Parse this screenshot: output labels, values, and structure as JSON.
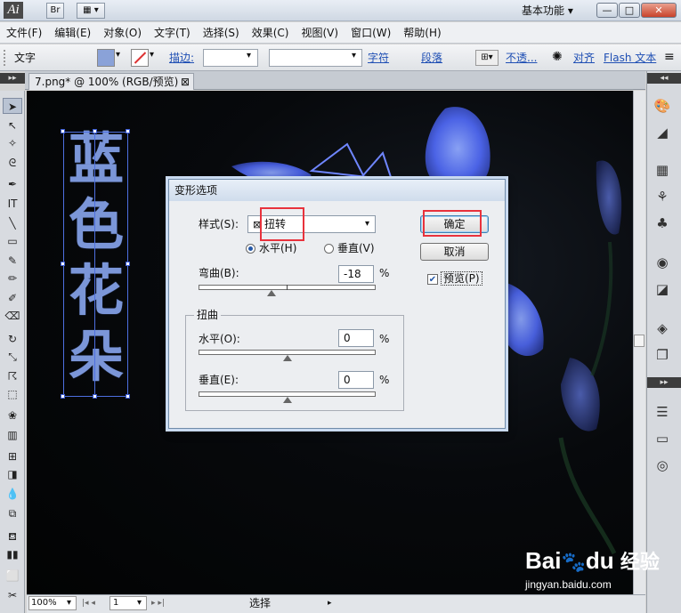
{
  "titlebar": {
    "app_logo": "Ai",
    "br_button": "Br",
    "workspace_label": "基本功能",
    "minimize": "—",
    "maximize": "□",
    "close": "✕"
  },
  "menubar": {
    "items": [
      "文件(F)",
      "编辑(E)",
      "对象(O)",
      "文字(T)",
      "选择(S)",
      "效果(C)",
      "视图(V)",
      "窗口(W)",
      "帮助(H)"
    ]
  },
  "controlbar": {
    "type_label": "文字",
    "stroke_label": "描边:",
    "char_link": "字符",
    "para_link": "段落",
    "opacity_link": "不透...",
    "align_link": "对齐",
    "flash_link": "Flash 文本"
  },
  "document": {
    "tab_title": "7.png* @ 100% (RGB/预览)",
    "tab_close": "⊠",
    "vertical_text": [
      "蓝",
      "色",
      "花",
      "朵"
    ]
  },
  "statusbar": {
    "zoom": "100%",
    "page": "1",
    "status_text": "选择"
  },
  "dialog": {
    "title": "变形选项",
    "style_label": "样式(S):",
    "style_value": "扭转",
    "horizontal_radio": "水平(H)",
    "vertical_radio": "垂直(V)",
    "bend_label": "弯曲(B):",
    "bend_value": "-18",
    "percent": "%",
    "distort_group": "扭曲",
    "distort_h_label": "水平(O):",
    "distort_h_value": "0",
    "distort_v_label": "垂直(E):",
    "distort_v_value": "0",
    "ok_button": "确定",
    "cancel_button": "取消",
    "preview_label": "预览(P)",
    "preview_checked": true,
    "bend_fraction": 0.41,
    "distort_h_fraction": 0.5,
    "distort_v_fraction": 0.5
  },
  "watermark": {
    "brand": "Bai",
    "brand2": "du",
    "brand_cn": "经验",
    "url": "jingyan.baidu.com"
  },
  "colors": {
    "accent_red": "#e8323c",
    "text_blue": "#7b96d8"
  }
}
